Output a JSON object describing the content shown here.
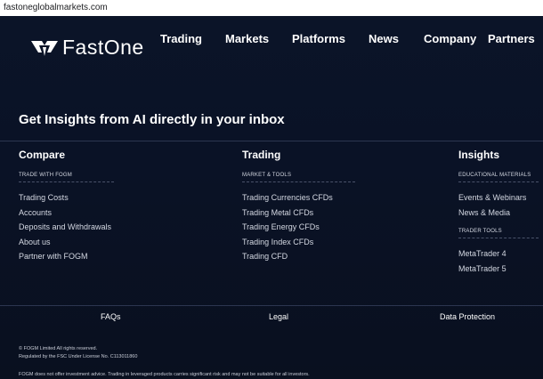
{
  "browser": {
    "url": "fastoneglobalmarkets.com"
  },
  "brand": {
    "name": "FastOne",
    "accent": "#ffffff",
    "background": "#0a1122"
  },
  "nav": {
    "items": [
      {
        "label": "Trading"
      },
      {
        "label": "Markets"
      },
      {
        "label": "Platforms"
      },
      {
        "label": "News"
      },
      {
        "label": "Company"
      },
      {
        "label": "Partners"
      }
    ]
  },
  "headline": "Get Insights from AI directly in your inbox",
  "columns": {
    "compare": {
      "title": "Compare",
      "subtitle": "TRADE WITH FOGM",
      "links": [
        "Trading Costs",
        "Accounts",
        "Deposits and Withdrawals",
        "About us",
        "Partner with FOGM"
      ]
    },
    "trading": {
      "title": "Trading",
      "subtitle": "MARKET & TOOLS",
      "links": [
        "Trading Currencies CFDs",
        "Trading Metal CFDs",
        "Trading Energy CFDs",
        "Trading Index CFDs",
        "Trading CFD"
      ]
    },
    "insights": {
      "title": "Insights",
      "subtitle": "EDUCATIONAL MATERIALS",
      "links": [
        "Events & Webinars",
        "News & Media"
      ],
      "subtitle2": "TRADER TOOLS",
      "links2": [
        "MetaTrader 4",
        "MetaTrader 5"
      ]
    }
  },
  "footer": {
    "faqs": "FAQs",
    "legal": "Legal",
    "data_protection": "Data Protection",
    "copyright": "© FOGM Limited All rights reserved.",
    "regulation": "Regulated by the FSC Under License No. C113011860",
    "disclaimer": "FOGM does not offer investment advice. Trading in leveraged products carries significant risk and may not be suitable for all investors."
  }
}
